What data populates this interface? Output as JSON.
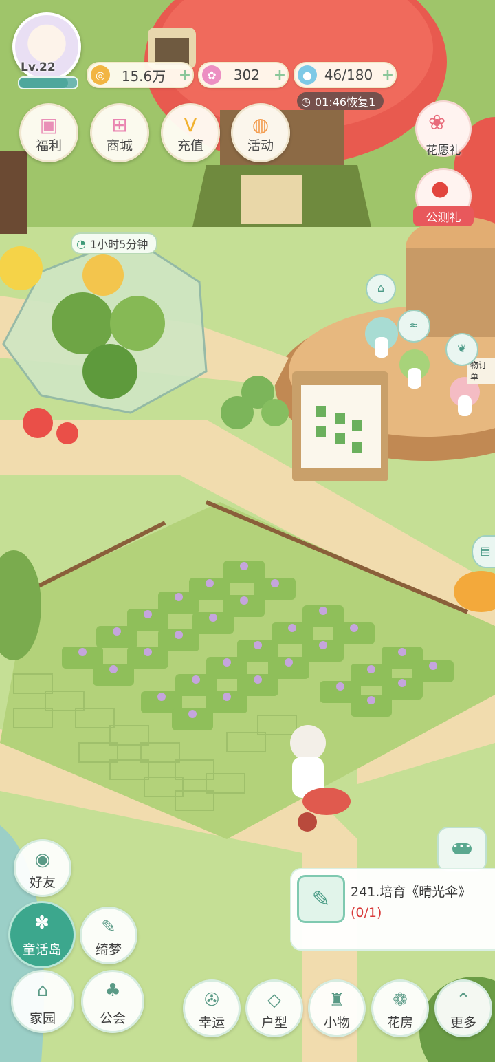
{
  "status": {
    "level": "Lv.22",
    "xp_fraction": 0.85,
    "coins": "15.6万",
    "gems": "302",
    "energy": "46/180",
    "energy_timer": "01:46恢复1",
    "plus": "+"
  },
  "top_buttons": [
    "福利",
    "商城",
    "充值",
    "活动"
  ],
  "right_buttons": {
    "wish": "花愿礼",
    "beta": "公测礼"
  },
  "greenhouse_timer": "1小时5分钟",
  "bottom_left": {
    "friends": "好友",
    "island": "童话岛",
    "dream": "绮梦",
    "home": "家园",
    "guild": "公会"
  },
  "bottom_bar": [
    "幸运",
    "户型",
    "小物",
    "花房",
    "更多"
  ],
  "quest": {
    "title": "241.培育《晴光伞》",
    "progress": "(0/1)"
  },
  "sign_text": "物订单",
  "colors": {
    "accent": "#3ca78d",
    "grass": "#bcd98c",
    "path": "#f1dcae",
    "red_label": "#e8585c"
  },
  "icons": {
    "coin": "coin-icon",
    "gem": "flower-gem-icon",
    "energy": "water-drop-icon",
    "chat": "chat-icon",
    "quest": "clipboard-icon"
  }
}
